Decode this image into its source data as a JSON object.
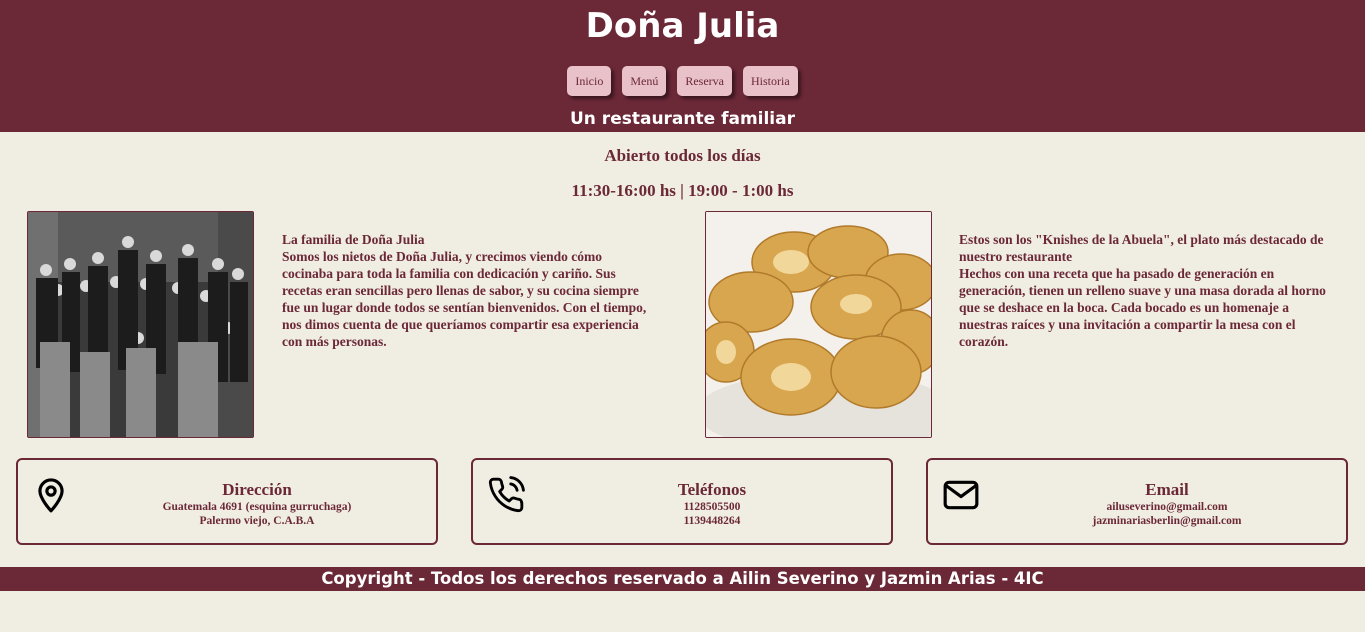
{
  "header": {
    "title": "Doña Julia",
    "nav": [
      "Inicio",
      "Menú",
      "Reserva",
      "Historia"
    ],
    "tagline": "Un restaurante familiar"
  },
  "hours": {
    "title": "Abierto todos los días",
    "schedule": "11:30-16:00 hs | 19:00 - 1:00 hs"
  },
  "family": {
    "heading": "La familia de Doña Julia",
    "body": "Somos los nietos de Doña Julia, y crecimos viendo cómo cocinaba para toda la familia con dedicación y cariño. Sus recetas eran sencillas pero llenas de sabor, y su cocina siempre fue un lugar donde todos se sentían bienvenidos. Con el tiempo, nos dimos cuenta de que queríamos compartir esa experiencia con más personas."
  },
  "dish": {
    "heading": "Estos son los \"Knishes de la Abuela\", el plato más destacado de nuestro restaurante",
    "body": "Hechos con una receta que ha pasado de generación en generación, tienen un relleno suave y una masa dorada al horno que se deshace en la boca. Cada bocado es un homenaje a nuestras raíces y una invitación a compartir la mesa con el corazón."
  },
  "contact": {
    "address": {
      "title": "Dirección",
      "lines": [
        "Guatemala 4691 (esquina gurruchaga)",
        "Palermo viejo, C.A.B.A"
      ],
      "icon": "map-pin-icon"
    },
    "phones": {
      "title": "Teléfonos",
      "lines": [
        "1128505500",
        "1139448264"
      ],
      "icon": "phone-icon"
    },
    "email": {
      "title": "Email",
      "lines": [
        "ailuseverino@gmail.com",
        "jazminariasberlin@gmail.com"
      ],
      "icon": "mail-icon"
    }
  },
  "footer": {
    "text": "Copyright - Todos los derechos reservado a Ailin Severino y Jazmin Arias - 4IC"
  },
  "colors": {
    "primary": "#6b2837",
    "background": "#f0ede3",
    "button": "#e8c1c9"
  }
}
